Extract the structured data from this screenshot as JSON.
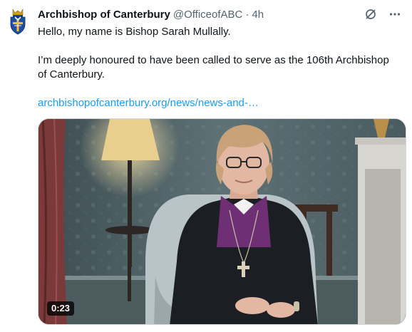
{
  "tweet": {
    "author_name": "Archbishop of Canterbury",
    "author_handle": "@OfficeofABC",
    "separator": "·",
    "time": "4h",
    "text_line1": "Hello, my name is Bishop Sarah Mullally.",
    "text_line2": "I’m deeply honoured to have been called to serve as the 106th Archbishop",
    "text_line3": "of Canterbury.",
    "link_text": "archbishopofcanterbury.org/news/news-and-…"
  },
  "video": {
    "duration": "0:23"
  },
  "icons": {
    "avatar": "canterbury-crest-icon",
    "grok": "grok-icon",
    "more": "more-horizontal-icon"
  },
  "colors": {
    "text": "#0f1419",
    "secondary": "#536471",
    "link": "#1d9bf0",
    "border": "#cfd9de"
  }
}
